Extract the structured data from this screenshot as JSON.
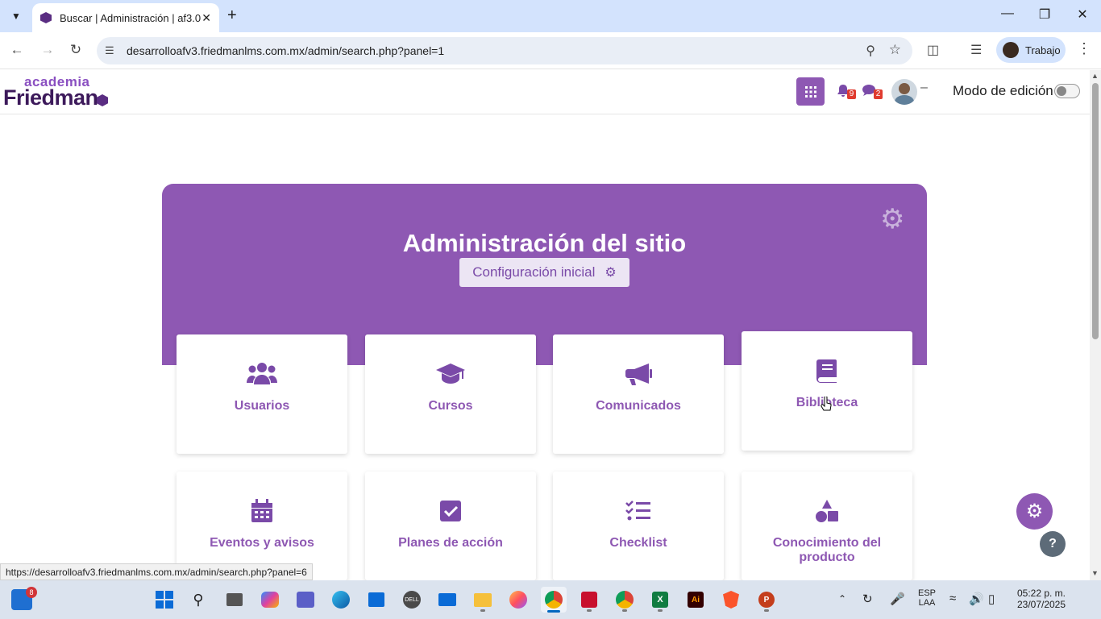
{
  "browser": {
    "tab_title": "Buscar | Administración | af3.0",
    "url": "desarrolloafv3.friedmanlms.com.mx/admin/search.php?panel=1",
    "profile_label": "Trabajo"
  },
  "header": {
    "logo_top": "academia",
    "logo_main": "Friedman",
    "notifications_count": "9",
    "messages_count": "2",
    "edit_mode_label": "Modo de edición",
    "edit_mode_on": false
  },
  "hero": {
    "title": "Administración del sitio",
    "config_button": "Configuración inicial"
  },
  "cards": [
    {
      "label": "Usuarios",
      "icon": "users-icon"
    },
    {
      "label": "Cursos",
      "icon": "graduation-cap-icon"
    },
    {
      "label": "Comunicados",
      "icon": "megaphone-icon"
    },
    {
      "label": "Biblioteca",
      "icon": "book-icon"
    },
    {
      "label": "Eventos y avisos",
      "icon": "calendar-icon"
    },
    {
      "label": "Planes de acción",
      "icon": "check-square-icon"
    },
    {
      "label": "Checklist",
      "icon": "checklist-icon"
    },
    {
      "label": "Conocimiento del producto",
      "icon": "shapes-icon"
    }
  ],
  "status_url": "https://desarrolloafv3.friedmanlms.com.mx/admin/search.php?panel=6",
  "taskbar": {
    "widgets_badge": "8",
    "lang_line1": "ESP",
    "lang_line2": "LAA",
    "time": "05:22 p. m.",
    "date": "23/07/2025"
  },
  "colors": {
    "brand_purple": "#8e58b3",
    "brand_dark": "#3d1a5b",
    "badge_red": "#e03b2f"
  }
}
